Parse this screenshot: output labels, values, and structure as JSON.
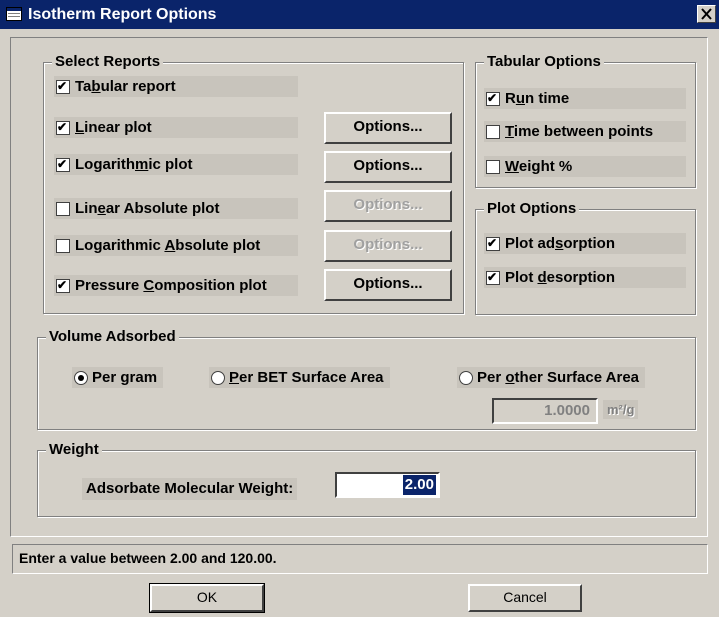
{
  "window": {
    "title": "Isotherm Report Options",
    "close_label": "✕"
  },
  "select_reports": {
    "legend": "Select Reports",
    "items": [
      {
        "label": "Tabular report",
        "checked": true
      },
      {
        "label": "Linear plot",
        "checked": true
      },
      {
        "label": "Logarithmic plot",
        "checked": true
      },
      {
        "label": "Linear Absolute plot",
        "checked": false
      },
      {
        "label": "Logarithmic Absolute plot",
        "checked": false
      },
      {
        "label": "Pressure Composition plot",
        "checked": true
      }
    ],
    "options_label": "Options..."
  },
  "tabular_options": {
    "legend": "Tabular Options",
    "items": [
      {
        "label": "Run time",
        "checked": true
      },
      {
        "label": "Time between points",
        "checked": false
      },
      {
        "label": "Weight %",
        "checked": false
      }
    ]
  },
  "plot_options": {
    "legend": "Plot Options",
    "items": [
      {
        "label": "Plot adsorption",
        "checked": true
      },
      {
        "label": "Plot desorption",
        "checked": true
      }
    ]
  },
  "volume_adsorbed": {
    "legend": "Volume Adsorbed",
    "radios": [
      {
        "label": "Per gram",
        "selected": true
      },
      {
        "label": "Per BET Surface Area",
        "selected": false
      },
      {
        "label": "Per other Surface Area",
        "selected": false
      }
    ],
    "surface_area_value": "1.0000",
    "surface_area_unit": "m²/g"
  },
  "weight": {
    "legend": "Weight",
    "label": "Adsorbate Molecular Weight:",
    "value": "2.00"
  },
  "status_text": "Enter a value between 2.00 and 120.00.",
  "buttons": {
    "ok": "OK",
    "cancel": "Cancel"
  }
}
